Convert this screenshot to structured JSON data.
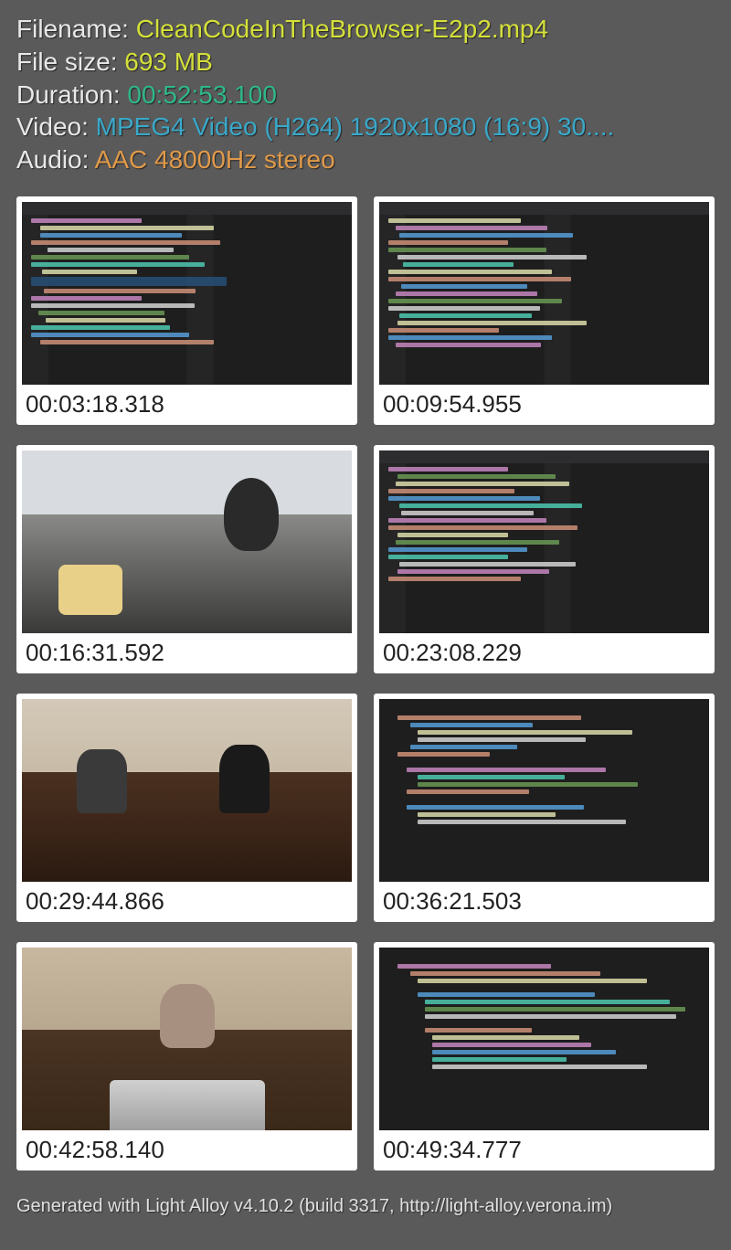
{
  "info": {
    "filename_label": "Filename: ",
    "filename_value": "CleanCodeInTheBrowser-E2p2.mp4",
    "filesize_label": "File size: ",
    "filesize_value": "693 MB",
    "duration_label": "Duration: ",
    "duration_value": "00:52:53.100",
    "video_label": "Video: ",
    "video_value": "MPEG4 Video (H264) 1920x1080 (16:9) 30....",
    "audio_label": "Audio: ",
    "audio_value": "AAC 48000Hz stereo"
  },
  "thumbs": [
    {
      "time": "00:03:18.318",
      "kind": "code"
    },
    {
      "time": "00:09:54.955",
      "kind": "code"
    },
    {
      "time": "00:16:31.592",
      "kind": "photo-car"
    },
    {
      "time": "00:23:08.229",
      "kind": "code"
    },
    {
      "time": "00:29:44.866",
      "kind": "photo-couch"
    },
    {
      "time": "00:36:21.503",
      "kind": "code"
    },
    {
      "time": "00:42:58.140",
      "kind": "photo-laptop"
    },
    {
      "time": "00:49:34.777",
      "kind": "code"
    }
  ],
  "footer": "Generated with Light Alloy v4.10.2 (build 3317, http://light-alloy.verona.im)"
}
